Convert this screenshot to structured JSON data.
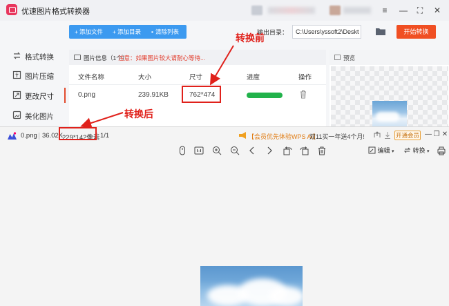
{
  "app": {
    "title": "优速图片格式转换器",
    "window_controls": [
      "≡",
      "—",
      "⛶",
      "✕"
    ]
  },
  "sidebar": {
    "items": [
      {
        "label": "格式转换",
        "icon": "format-convert-icon"
      },
      {
        "label": "图片压缩",
        "icon": "compress-icon"
      },
      {
        "label": "更改尺寸",
        "icon": "resize-icon",
        "active": true
      },
      {
        "label": "美化图片",
        "icon": "beautify-icon"
      }
    ]
  },
  "toolbar": {
    "add_file": "添加文件",
    "add_dir": "添加目录",
    "clear_list": "清除列表",
    "output_label": "输出目录：",
    "output_path": "C:\\Users\\yssoft2\\Deskt",
    "start": "开始转换"
  },
  "file_panel": {
    "head_info": "图片信息（1个）",
    "head_notice": "注意：如果图片较大请耐心等待...",
    "columns": [
      "文件名称",
      "大小",
      "尺寸",
      "进度",
      "操作"
    ],
    "rows": [
      {
        "name": "0.png",
        "size": "239.91KB",
        "dims": "762*474",
        "progress": 1.0
      }
    ]
  },
  "preview": {
    "title": "预览"
  },
  "annotations": {
    "before": "转换前",
    "after": "转换后"
  },
  "viewer": {
    "file_name": "0.png",
    "file_size": "36.02K",
    "dims": "229*142像素",
    "page": "1/1",
    "promo_a": "【会员优先体验WPS AI】",
    "promo_b": "双11买一年送4个月!",
    "vip_button": "开通会员",
    "edit_label": "编辑",
    "convert_label": "转换",
    "window_controls": [
      "—",
      "❐",
      "✕"
    ]
  },
  "colors": {
    "accent_blue": "#3c9af0",
    "start_orange": "#f04f23",
    "annotation_red": "#e0211b",
    "progress_green": "#21b24b"
  }
}
